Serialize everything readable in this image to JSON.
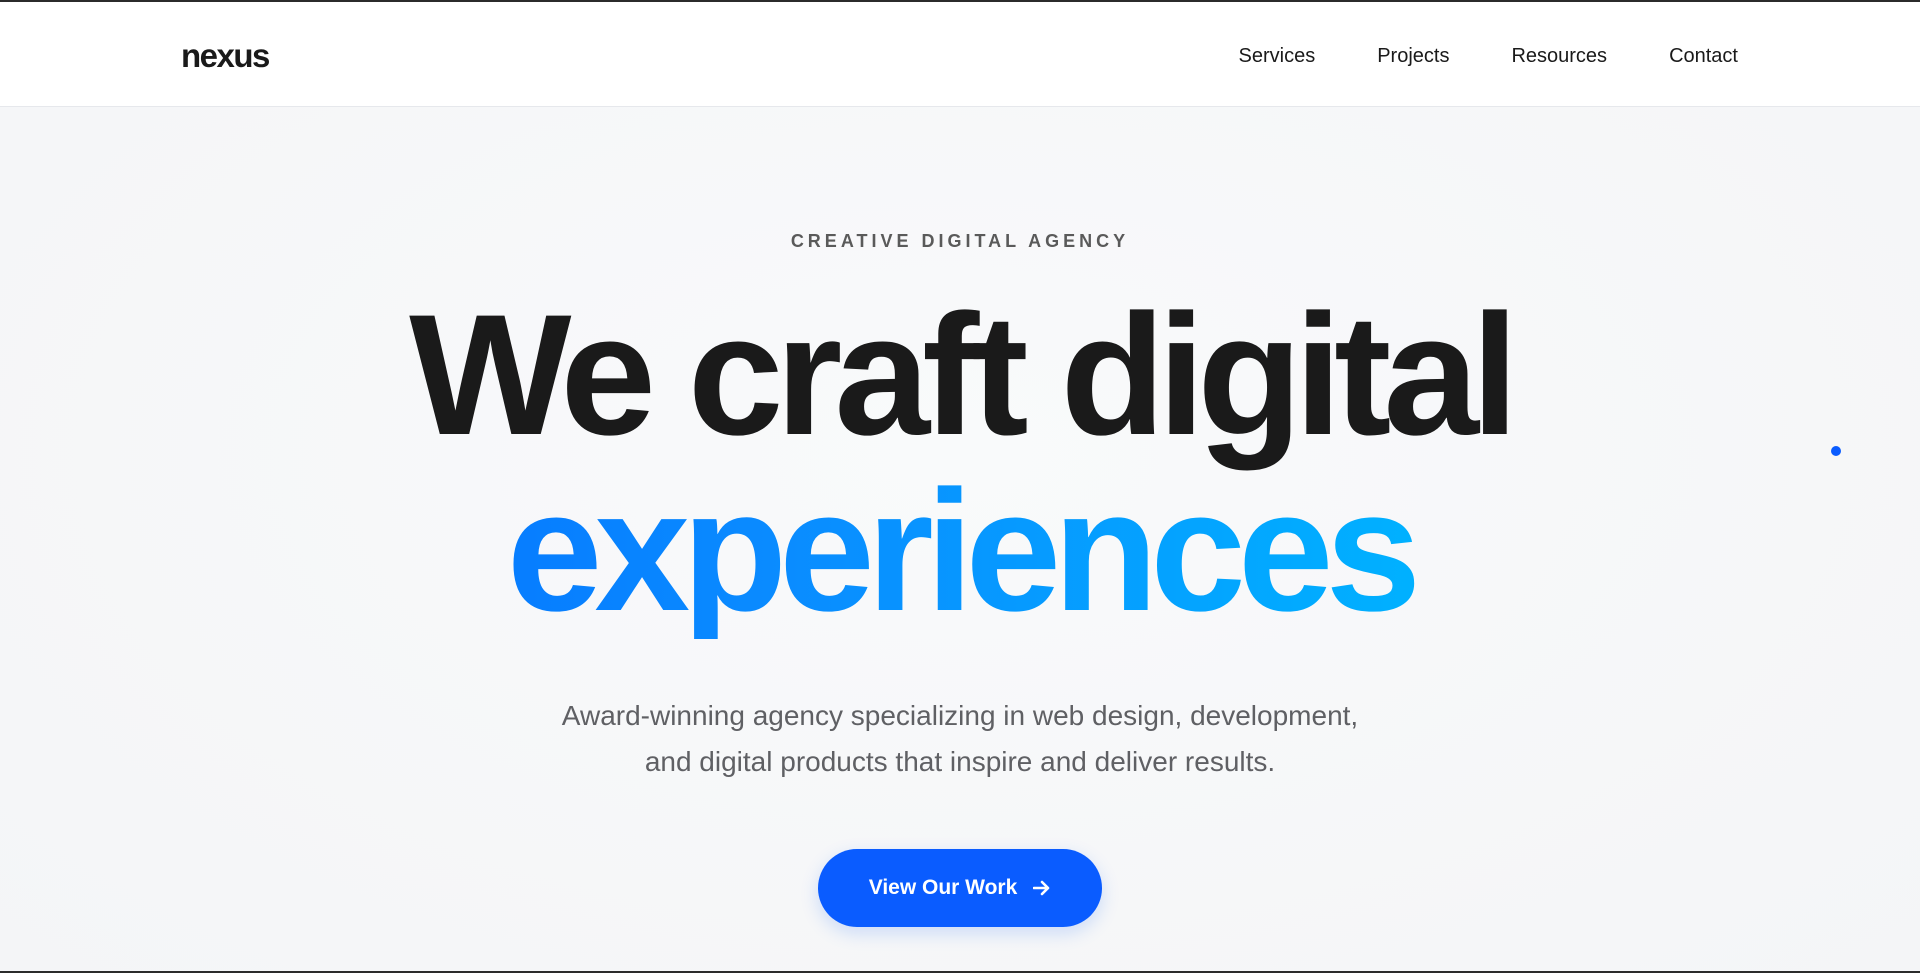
{
  "header": {
    "logo": "nexus",
    "nav": [
      {
        "label": "Services"
      },
      {
        "label": "Projects"
      },
      {
        "label": "Resources"
      },
      {
        "label": "Contact"
      }
    ]
  },
  "hero": {
    "eyebrow": "CREATIVE DIGITAL AGENCY",
    "headline_line1": "We craft digital",
    "headline_line2": "experiences",
    "subtitle_line1": "Award-winning agency specializing in web design, development,",
    "subtitle_line2": "and digital products that inspire and deliver results.",
    "cta_label": "View Our Work",
    "cta_icon": "arrow-right-icon"
  },
  "colors": {
    "accent": "#0a5cff",
    "gradient_start": "#0062ff",
    "gradient_end": "#00d4ff",
    "text_dark": "#1a1a1a",
    "text_muted": "#5f6064",
    "background": "#f7f8fa"
  }
}
